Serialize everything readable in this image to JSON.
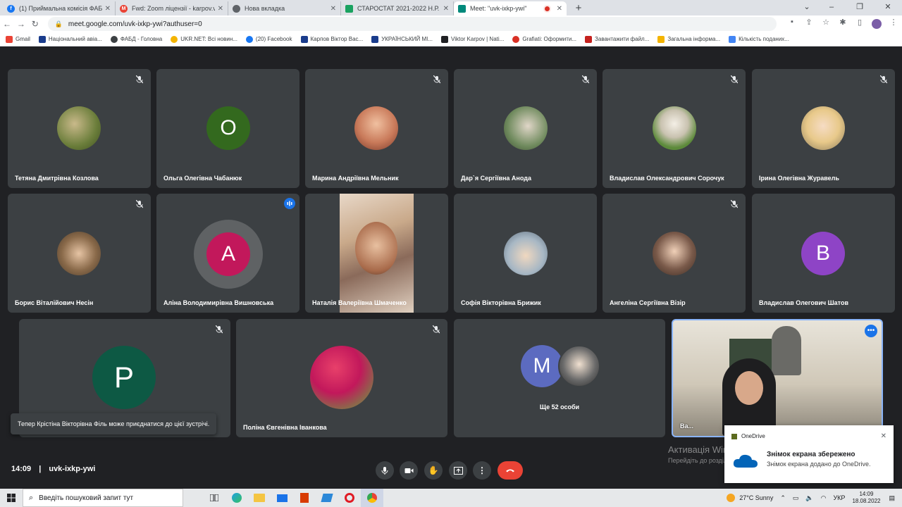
{
  "browser": {
    "tabs": [
      {
        "label": "(1) Приймальна комісія ФАБД Н",
        "favicon": "facebook",
        "color": "#1877f2"
      },
      {
        "label": "Fwd: Zoom ліцензії - karpov.vikt",
        "favicon": "gmail",
        "color": "#ea4335"
      },
      {
        "label": "Нова вкладка",
        "favicon": "chrome",
        "color": "#5f6368"
      },
      {
        "label": "СТАРОСТАТ 2021-2022 Н.Р.",
        "favicon": "sheets",
        "color": "#1aa260"
      },
      {
        "label": "Meet: \"uvk-ixkp-ywi\"",
        "favicon": "meet",
        "color": "#00897b"
      }
    ],
    "url": "meet.google.com/uvk-ixkp-ywi?authuser=0",
    "bookmarks": [
      {
        "label": "Gmail",
        "color": "#ea4335"
      },
      {
        "label": "Національний авіа...",
        "color": "#1a3c8c"
      },
      {
        "label": "ФАБД - Головна",
        "color": "#3c4043"
      },
      {
        "label": "UKR.NET: Всі новин...",
        "color": "#f4b400"
      },
      {
        "label": "(20) Facebook",
        "color": "#1877f2"
      },
      {
        "label": "Карпов Віктор Вас...",
        "color": "#1a3c8c"
      },
      {
        "label": "УКРАЇНСЬКИЙ МІ...",
        "color": "#1a3c8c"
      },
      {
        "label": "Viktor Karpov | Nati...",
        "color": "#202124"
      },
      {
        "label": "Grafiati: Оформити...",
        "color": "#d93025"
      },
      {
        "label": "Завантажити файл...",
        "color": "#c5221f"
      },
      {
        "label": "Загальна інформа...",
        "color": "#f4b400"
      },
      {
        "label": "Кількість поданих...",
        "color": "#4285f4"
      }
    ]
  },
  "meeting": {
    "participants": [
      {
        "name": "Тетяна Дмитрівна Козлова",
        "avatar": "photo",
        "color": "#6a7d3a"
      },
      {
        "name": "Ольга Олегівна Чабанюк",
        "avatar": "letter",
        "letter": "О",
        "color": "#33691e"
      },
      {
        "name": "Марина Андріївна Мельник",
        "avatar": "photo",
        "color": "#c97a5a"
      },
      {
        "name": "Дар`я Сергіївна Анода",
        "avatar": "photo",
        "color": "#6f8a5d"
      },
      {
        "name": "Владислав Олександрович Сорочук",
        "avatar": "photo",
        "color": "#5c8a3a"
      },
      {
        "name": "Ірина Олегівна Журавель",
        "avatar": "photo",
        "color": "#c9b48a"
      },
      {
        "name": "Борис Віталійович Несін",
        "avatar": "photo",
        "color": "#8a6a4a"
      },
      {
        "name": "Аліна Володимирівна Вишновська",
        "avatar": "letter",
        "letter": "A",
        "color": "#c2185b"
      },
      {
        "name": "Наталія Валеріївна Шмаченко",
        "avatar": "video",
        "color": "#c9a98a"
      },
      {
        "name": "Софія Вікторівна Брижик",
        "avatar": "photo",
        "color": "#a7b7c4"
      },
      {
        "name": "Ангеліна Сергіївна Візір",
        "avatar": "photo",
        "color": "#7a5a4a"
      },
      {
        "name": "Владислав Олегович Шатов",
        "avatar": "letter",
        "letter": "B",
        "color": "#8e44c6"
      },
      {
        "name": "",
        "avatar": "letter",
        "letter": "P",
        "color": "#0d5944"
      },
      {
        "name": "Поліна Євгенівна Іванкова",
        "avatar": "photo",
        "color": "#c2185b"
      },
      {
        "name": "Ще 52 особи",
        "avatar": "group",
        "letter": "M",
        "color": "#5c6bc0"
      },
      {
        "name": "Ва...",
        "avatar": "video",
        "color": "#b9a98f"
      }
    ],
    "toast": "Тепер Крістіна Вікторівна Філь може приєднатися до цієї зустрічі.",
    "time": "14:09",
    "code": "uvk-ixkp-ywi",
    "controls": [
      "mic",
      "camera",
      "raise-hand",
      "present",
      "more",
      "end-call"
    ]
  },
  "notification": {
    "app": "OneDrive",
    "title": "Знімок екрана збережено",
    "body": "Знімок екрана додано до OneDrive."
  },
  "activation": {
    "line1": "Активація Windows",
    "line2": "Перейдіть до розділу Параметри"
  },
  "taskbar": {
    "search_placeholder": "Введіть пошуковий запит тут",
    "weather": "27°C  Sunny",
    "language": "УКР",
    "time": "14:09",
    "date": "18.08.2022"
  }
}
